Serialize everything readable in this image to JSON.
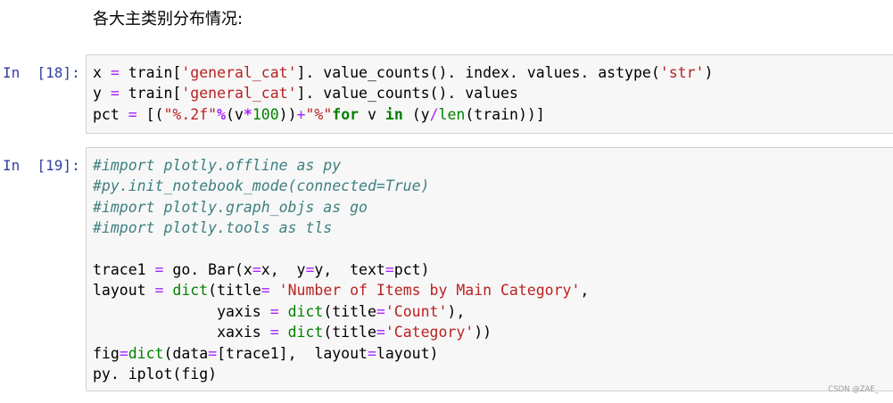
{
  "markdown": {
    "heading": "各大主类别分布情况:"
  },
  "cells": [
    {
      "prompt": "In  [18]:",
      "lines": [
        [
          {
            "t": "plain",
            "v": "x "
          },
          {
            "t": "opn",
            "v": "="
          },
          {
            "t": "plain",
            "v": " train["
          },
          {
            "t": "str",
            "v": "'general_cat'"
          },
          {
            "t": "plain",
            "v": "]. value_counts(). index. values. astype("
          },
          {
            "t": "str",
            "v": "'str'"
          },
          {
            "t": "plain",
            "v": ")"
          }
        ],
        [
          {
            "t": "plain",
            "v": "y "
          },
          {
            "t": "opn",
            "v": "="
          },
          {
            "t": "plain",
            "v": " train["
          },
          {
            "t": "str",
            "v": "'general_cat'"
          },
          {
            "t": "plain",
            "v": "]. value_counts(). values"
          }
        ],
        [
          {
            "t": "plain",
            "v": "pct "
          },
          {
            "t": "opn",
            "v": "="
          },
          {
            "t": "plain",
            "v": " [("
          },
          {
            "t": "str",
            "v": "\"%.2f\""
          },
          {
            "t": "op",
            "v": "%"
          },
          {
            "t": "plain",
            "v": "(v"
          },
          {
            "t": "op",
            "v": "*"
          },
          {
            "t": "num",
            "v": "100"
          },
          {
            "t": "plain",
            "v": "))"
          },
          {
            "t": "opn",
            "v": "+"
          },
          {
            "t": "str",
            "v": "\"%\""
          },
          {
            "t": "kw",
            "v": "for"
          },
          {
            "t": "plain",
            "v": " v "
          },
          {
            "t": "kw",
            "v": "in"
          },
          {
            "t": "plain",
            "v": " (y"
          },
          {
            "t": "opn",
            "v": "/"
          },
          {
            "t": "builtin",
            "v": "len"
          },
          {
            "t": "plain",
            "v": "(train))]"
          }
        ]
      ]
    },
    {
      "prompt": "In  [19]:",
      "lines": [
        [
          {
            "t": "com",
            "v": "#import plotly.offline as py"
          }
        ],
        [
          {
            "t": "com",
            "v": "#py.init_notebook_mode(connected=True)"
          }
        ],
        [
          {
            "t": "com",
            "v": "#import plotly.graph_objs as go"
          }
        ],
        [
          {
            "t": "com",
            "v": "#import plotly.tools as tls"
          }
        ],
        [],
        [
          {
            "t": "plain",
            "v": "trace1 "
          },
          {
            "t": "opn",
            "v": "="
          },
          {
            "t": "plain",
            "v": " go. Bar(x"
          },
          {
            "t": "opn",
            "v": "="
          },
          {
            "t": "plain",
            "v": "x,  y"
          },
          {
            "t": "opn",
            "v": "="
          },
          {
            "t": "plain",
            "v": "y,  text"
          },
          {
            "t": "opn",
            "v": "="
          },
          {
            "t": "plain",
            "v": "pct)"
          }
        ],
        [
          {
            "t": "plain",
            "v": "layout "
          },
          {
            "t": "opn",
            "v": "="
          },
          {
            "t": "plain",
            "v": " "
          },
          {
            "t": "builtin",
            "v": "dict"
          },
          {
            "t": "plain",
            "v": "(title"
          },
          {
            "t": "opn",
            "v": "="
          },
          {
            "t": "plain",
            "v": " "
          },
          {
            "t": "str",
            "v": "'Number of Items by Main Category'"
          },
          {
            "t": "plain",
            "v": ","
          }
        ],
        [
          {
            "t": "plain",
            "v": "              yaxis "
          },
          {
            "t": "opn",
            "v": "="
          },
          {
            "t": "plain",
            "v": " "
          },
          {
            "t": "builtin",
            "v": "dict"
          },
          {
            "t": "plain",
            "v": "(title"
          },
          {
            "t": "opn",
            "v": "="
          },
          {
            "t": "str",
            "v": "'Count'"
          },
          {
            "t": "plain",
            "v": "),"
          }
        ],
        [
          {
            "t": "plain",
            "v": "              xaxis "
          },
          {
            "t": "opn",
            "v": "="
          },
          {
            "t": "plain",
            "v": " "
          },
          {
            "t": "builtin",
            "v": "dict"
          },
          {
            "t": "plain",
            "v": "(title"
          },
          {
            "t": "opn",
            "v": "="
          },
          {
            "t": "str",
            "v": "'Category'"
          },
          {
            "t": "plain",
            "v": "))"
          }
        ],
        [
          {
            "t": "plain",
            "v": "fig"
          },
          {
            "t": "opn",
            "v": "="
          },
          {
            "t": "builtin",
            "v": "dict"
          },
          {
            "t": "plain",
            "v": "(data"
          },
          {
            "t": "opn",
            "v": "="
          },
          {
            "t": "plain",
            "v": "[trace1],  layout"
          },
          {
            "t": "opn",
            "v": "="
          },
          {
            "t": "plain",
            "v": "layout)"
          }
        ],
        [
          {
            "t": "plain",
            "v": "py. iplot(fig)"
          }
        ]
      ]
    }
  ],
  "watermark": "CSDN @ZAE_",
  "colors": {
    "prompt": "#303f9f",
    "string": "#ba2121",
    "keyword": "#008000",
    "operator": "#aa22ff",
    "comment": "#408080",
    "cell_background": "#f7f7f7",
    "cell_border": "#cfcfcf"
  }
}
